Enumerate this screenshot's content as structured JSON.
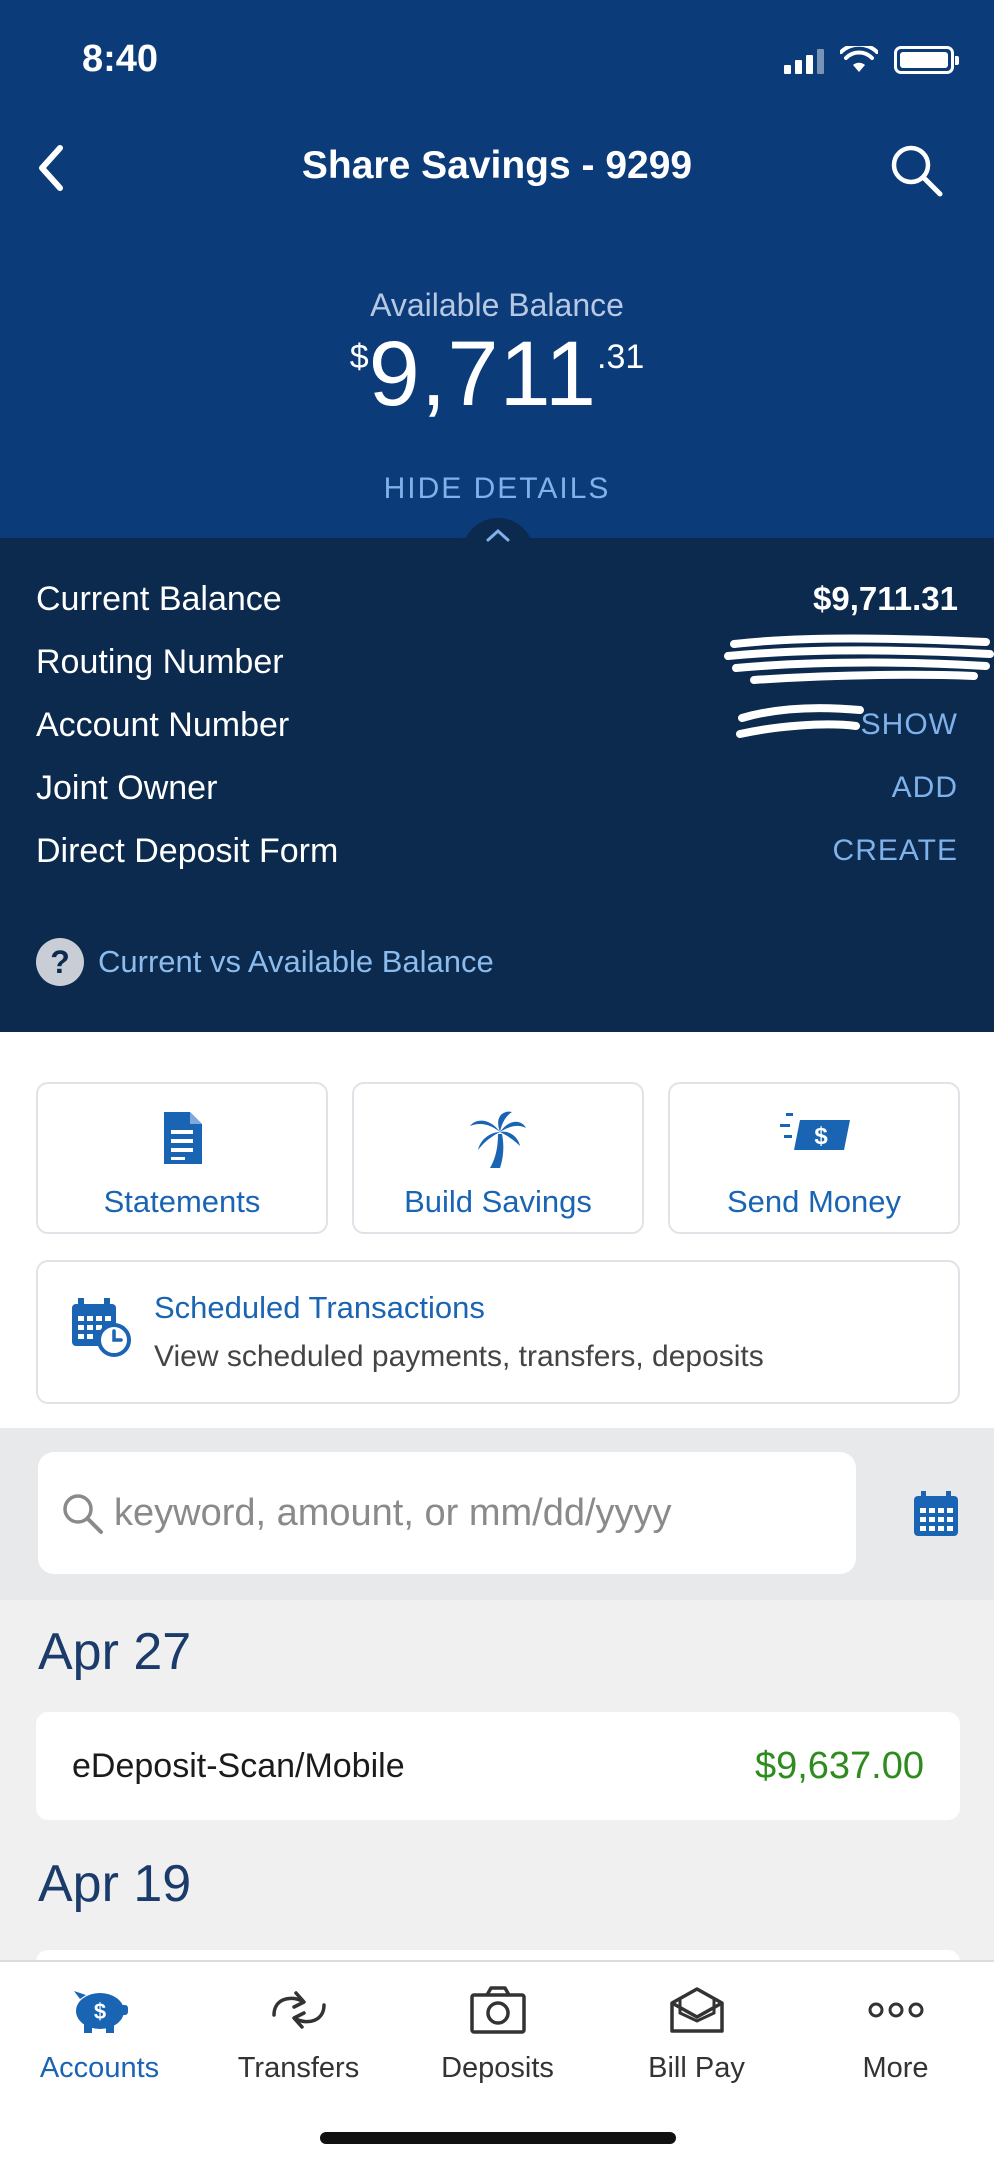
{
  "status_bar": {
    "time": "8:40"
  },
  "nav": {
    "title": "Share Savings - 9299"
  },
  "balance": {
    "label": "Available Balance",
    "currency_symbol": "$",
    "whole": "9,711",
    "cents": ".31",
    "toggle_label": "HIDE DETAILS"
  },
  "details": {
    "rows": [
      {
        "label": "Current Balance",
        "value": "$9,711.31"
      },
      {
        "label": "Routing Number",
        "value": ""
      },
      {
        "label": "Account Number",
        "value": "SHOW"
      },
      {
        "label": "Joint Owner",
        "value": "ADD"
      },
      {
        "label": "Direct Deposit Form",
        "value": "CREATE"
      }
    ],
    "help_link": "Current vs Available Balance"
  },
  "quick_actions": [
    {
      "label": "Statements",
      "icon": "document-icon"
    },
    {
      "label": "Build Savings",
      "icon": "palm-tree-icon"
    },
    {
      "label": "Send Money",
      "icon": "send-money-icon"
    }
  ],
  "scheduled": {
    "title": "Scheduled Transactions",
    "subtitle": "View scheduled payments, transfers, deposits"
  },
  "search": {
    "placeholder": "keyword, amount, or mm/dd/yyyy"
  },
  "transactions": [
    {
      "date": "Apr 27",
      "items": [
        {
          "description": "eDeposit-Scan/Mobile",
          "amount": "$9,637.00"
        }
      ]
    },
    {
      "date": "Apr 19",
      "items": []
    }
  ],
  "tabs": [
    {
      "label": "Accounts",
      "icon": "piggy-bank-icon",
      "active": true
    },
    {
      "label": "Transfers",
      "icon": "transfer-icon",
      "active": false
    },
    {
      "label": "Deposits",
      "icon": "camera-icon",
      "active": false
    },
    {
      "label": "Bill Pay",
      "icon": "envelope-icon",
      "active": false
    },
    {
      "label": "More",
      "icon": "more-icon",
      "active": false
    }
  ],
  "colors": {
    "header_blue": "#0b3b78",
    "details_navy": "#0b2a4d",
    "link_blue": "#1a64b4",
    "positive_green": "#2e8b1e"
  }
}
